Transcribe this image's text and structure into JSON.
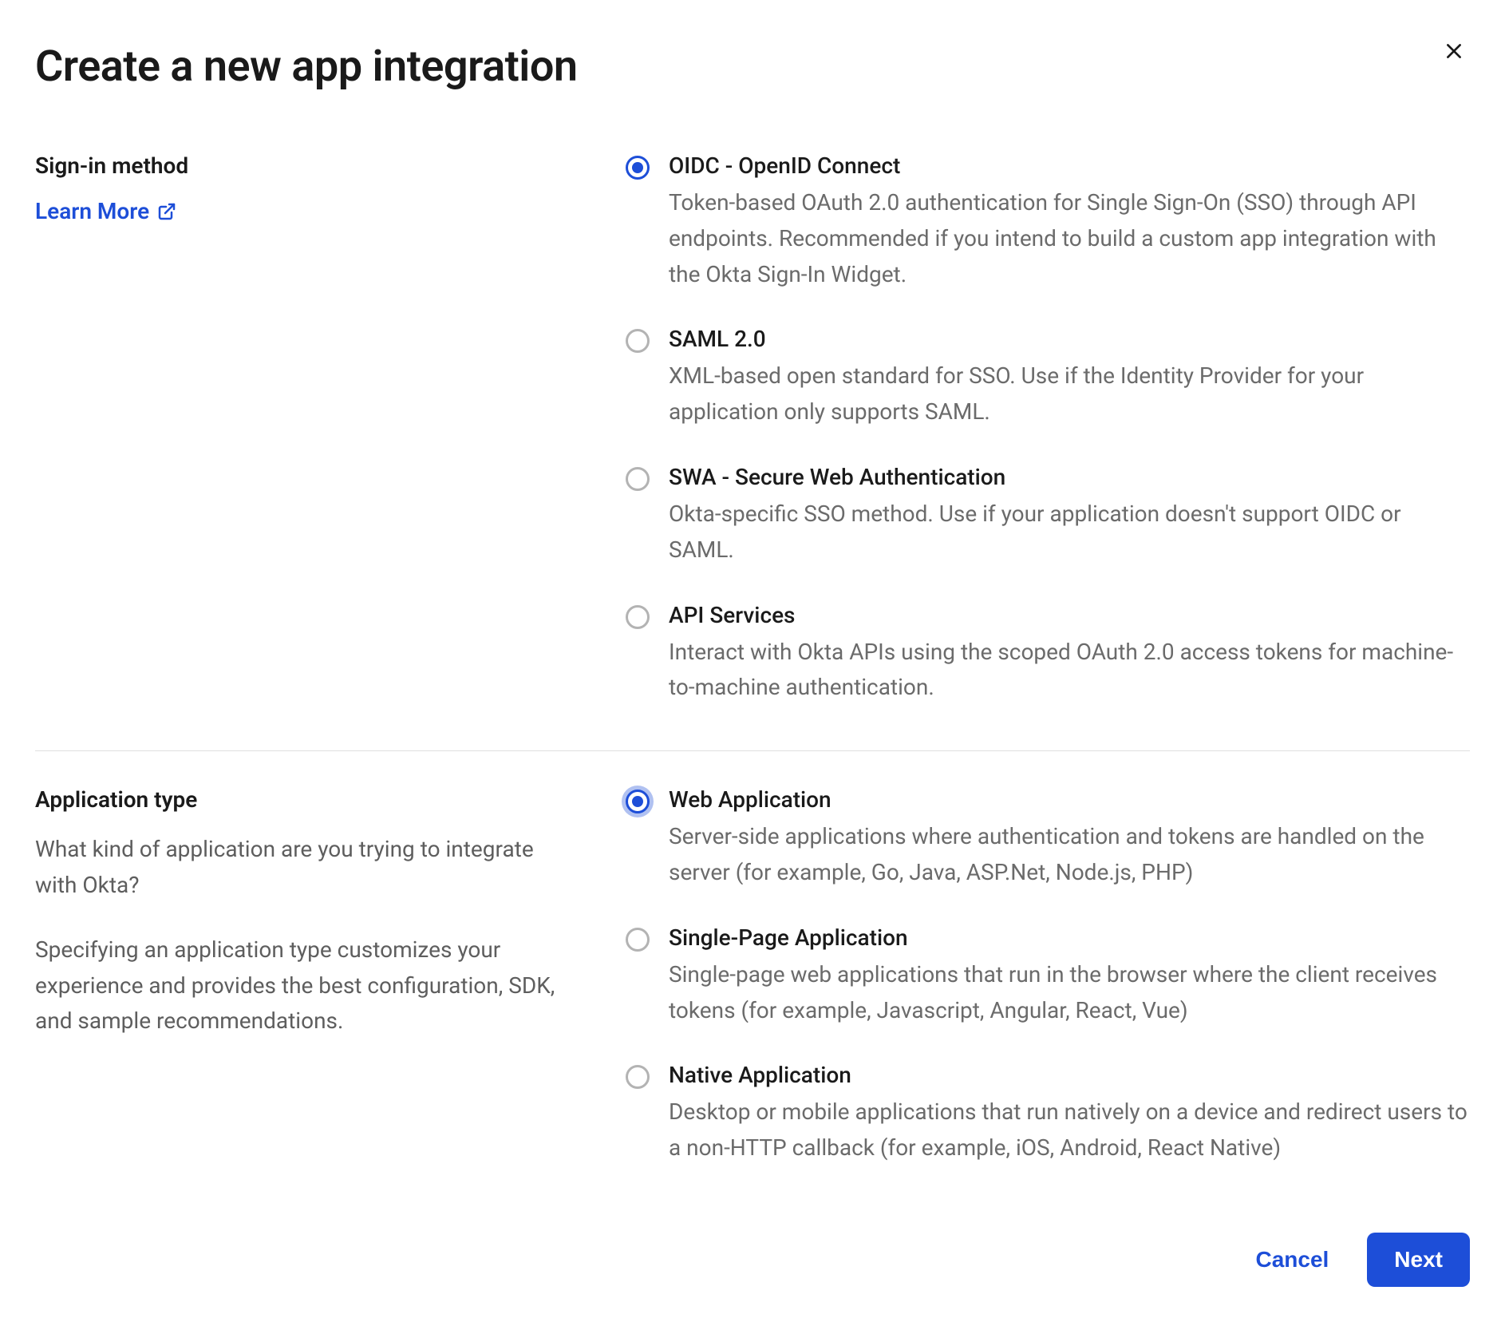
{
  "title": "Create a new app integration",
  "sections": {
    "signin": {
      "label": "Sign-in method",
      "learn_more": "Learn More",
      "options": [
        {
          "id": "oidc",
          "title": "OIDC - OpenID Connect",
          "desc": "Token-based OAuth 2.0 authentication for Single Sign-On (SSO) through API endpoints. Recommended if you intend to build a custom app integration with the Okta Sign-In Widget.",
          "selected": true
        },
        {
          "id": "saml",
          "title": "SAML 2.0",
          "desc": "XML-based open standard for SSO. Use if the Identity Provider for your application only supports SAML.",
          "selected": false
        },
        {
          "id": "swa",
          "title": "SWA - Secure Web Authentication",
          "desc": "Okta-specific SSO method. Use if your application doesn't support OIDC or SAML.",
          "selected": false
        },
        {
          "id": "api",
          "title": "API Services",
          "desc": "Interact with Okta APIs using the scoped OAuth 2.0 access tokens for machine-to-machine authentication.",
          "selected": false
        }
      ]
    },
    "apptype": {
      "label": "Application type",
      "desc1": "What kind of application are you trying to integrate with Okta?",
      "desc2": "Specifying an application type customizes your experience and provides the best configuration, SDK, and sample recommendations.",
      "options": [
        {
          "id": "web",
          "title": "Web Application",
          "desc": "Server-side applications where authentication and tokens are handled on the server (for example, Go, Java, ASP.Net, Node.js, PHP)",
          "selected": true,
          "focused": true
        },
        {
          "id": "spa",
          "title": "Single-Page Application",
          "desc": "Single-page web applications that run in the browser where the client receives tokens (for example, Javascript, Angular, React, Vue)",
          "selected": false
        },
        {
          "id": "native",
          "title": "Native Application",
          "desc": "Desktop or mobile applications that run natively on a device and redirect users to a non-HTTP callback (for example, iOS, Android, React Native)",
          "selected": false
        }
      ]
    }
  },
  "footer": {
    "cancel": "Cancel",
    "next": "Next"
  }
}
